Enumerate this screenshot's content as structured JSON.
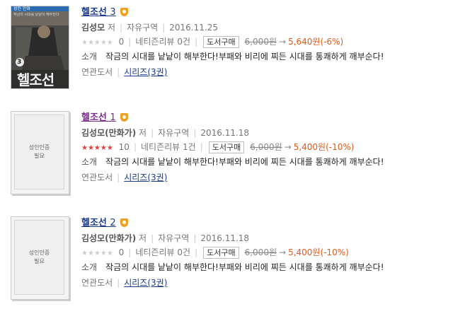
{
  "results": [
    {
      "title": "헬조선",
      "volume": "3",
      "cover": {
        "type": "image",
        "vol_number": "3",
        "cover_title": "헬조선",
        "top_strip": "성인 만화",
        "mid_text": "작금의 시대를 낱낱이 해부한다"
      },
      "author": "김성모",
      "author_suffix": "저",
      "publisher": "자유구역",
      "date": "2016.11.25",
      "stars_filled": 0,
      "rating_count": "0",
      "review_label": "네티즌리뷰",
      "review_count": "0건",
      "buy_label": "도서구매",
      "price_original": "6,000원",
      "arrow": "→",
      "price_sale": "5,640원(-6%)",
      "intro_label": "소개",
      "description": "작금의 시대를 낱낱이 해부한다!부패와 비리에 찌든 시대를 통쾌하게 깨부순다!",
      "related_label": "연관도서",
      "series_link": "시리즈(3권)"
    },
    {
      "title": "헬조선",
      "volume": "1",
      "cover": {
        "type": "adult",
        "line1": "성인인증",
        "line2": "필요"
      },
      "author": "김성모(만화가)",
      "author_suffix": "저",
      "publisher": "자유구역",
      "date": "2016.11.18",
      "stars_filled": 5,
      "rating_count": "10",
      "review_label": "네티즌리뷰",
      "review_count": "1건",
      "buy_label": "도서구매",
      "price_original": "6,000원",
      "arrow": "→",
      "price_sale": "5,400원(-10%)",
      "intro_label": "소개",
      "description": "작금의 시대를 낱낱이 해부한다!부패와 비리에 찌든 시대를 통쾌하게 깨부순다!",
      "related_label": "연관도서",
      "series_link": "시리즈(3권)"
    },
    {
      "title": "헬조선",
      "volume": "2",
      "cover": {
        "type": "adult",
        "line1": "성인인증",
        "line2": "필요"
      },
      "author": "김성모(만화가)",
      "author_suffix": "저",
      "publisher": "자유구역",
      "date": "2016.11.18",
      "stars_filled": 0,
      "rating_count": "0",
      "review_label": "네티즌리뷰",
      "review_count": "0건",
      "buy_label": "도서구매",
      "price_original": "6,000원",
      "arrow": "→",
      "price_sale": "5,400원(-10%)",
      "intro_label": "소개",
      "description": "작금의 시대를 낱낱이 해부한다!부패와 비리에 찌든 시대를 통쾌하게 깨부순다!",
      "related_label": "연관도서",
      "series_link": "시리즈(3권)"
    }
  ],
  "colors": {
    "title": "#1a3a8a",
    "title_visited": "#7a2a8a",
    "sale": "#e05a1a",
    "star_on": "#e2403a",
    "star_off": "#cfcfcf",
    "adult_badge": "#f0a020"
  }
}
